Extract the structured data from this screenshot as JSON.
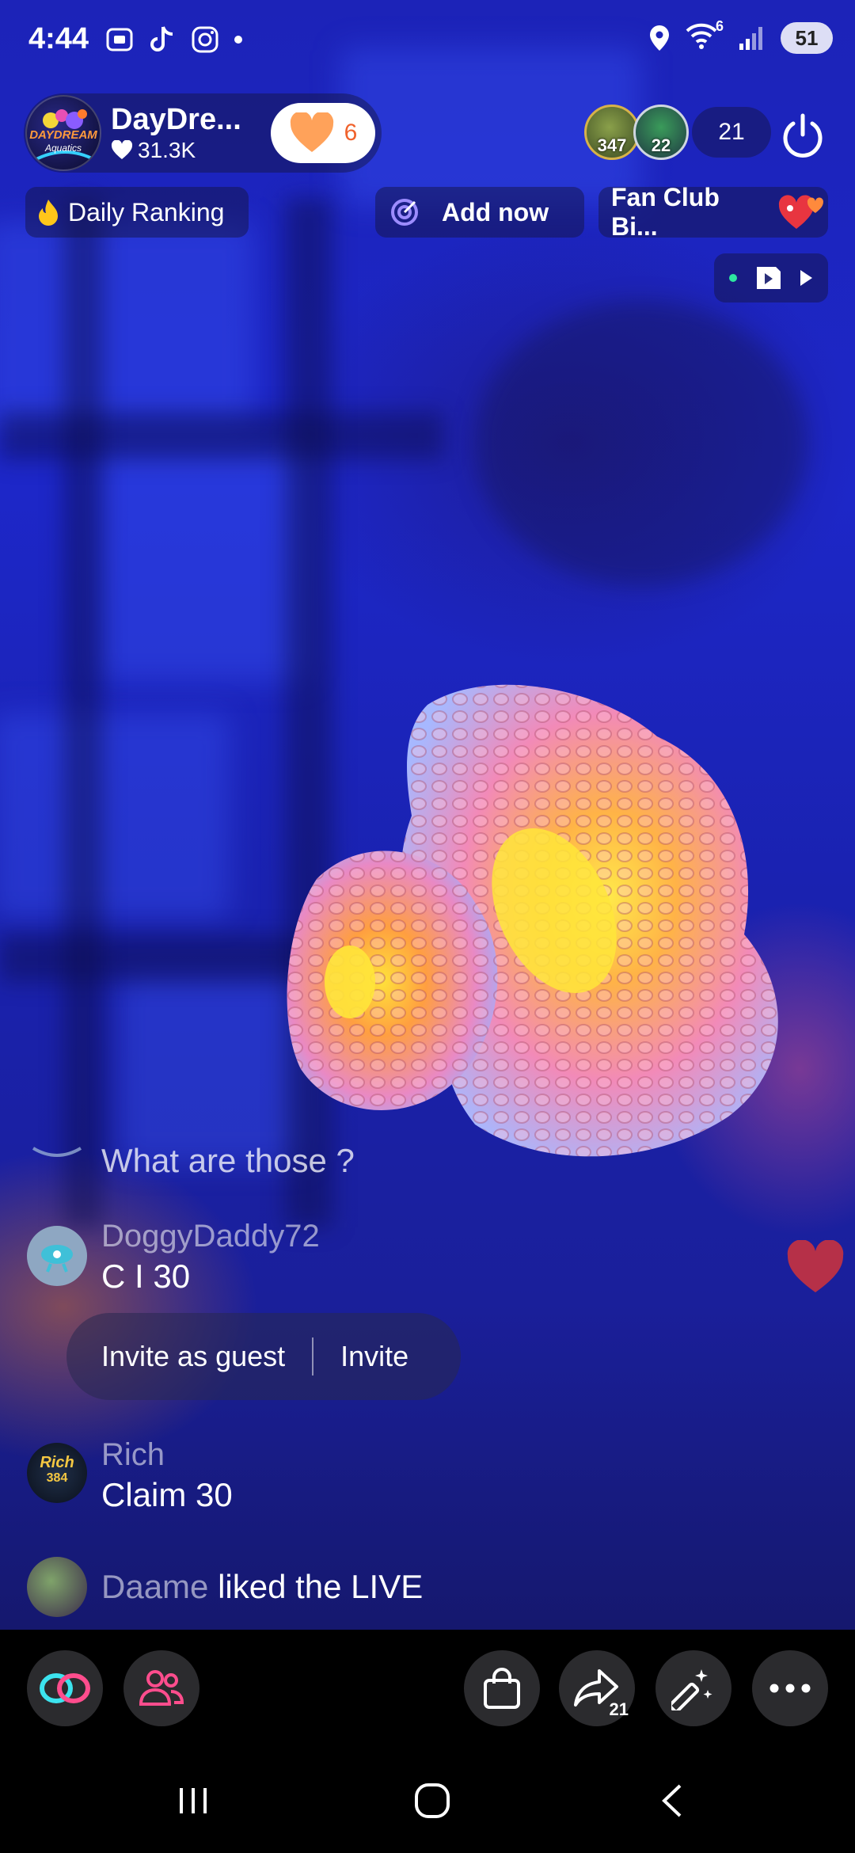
{
  "status_bar": {
    "time": "4:44",
    "battery": "51",
    "wifi_badge": "6"
  },
  "host": {
    "name": "DayDre...",
    "likes": "31.3K",
    "logo_text": "DAYDREAM",
    "logo_sub": "Aquatics",
    "follow_count": "6"
  },
  "viewers": {
    "top1_score": "347",
    "top2_score": "22",
    "count": "21"
  },
  "chips": {
    "ranking": "Daily Ranking",
    "add": "Add now",
    "fanclub": "Fan Club Bi..."
  },
  "chat": {
    "messages": [
      {
        "user": "",
        "text": "What are those ?"
      },
      {
        "user": "DoggyDaddy72",
        "text": "C I 30"
      },
      {
        "user": "Rich",
        "text": "Claim 30"
      },
      {
        "user": "Daame",
        "text": "liked the LIVE"
      }
    ],
    "invite_guest": "Invite as guest",
    "invite": "Invite",
    "rich_avatar_text": "Rich",
    "rich_avatar_num": "384"
  },
  "toolbar": {
    "share_count": "21"
  },
  "colors": {
    "accent_pink": "#ff4d8d",
    "accent_cyan": "#3ce3ee",
    "heart_red": "#c8323f",
    "follow_orange": "#f0622c"
  }
}
